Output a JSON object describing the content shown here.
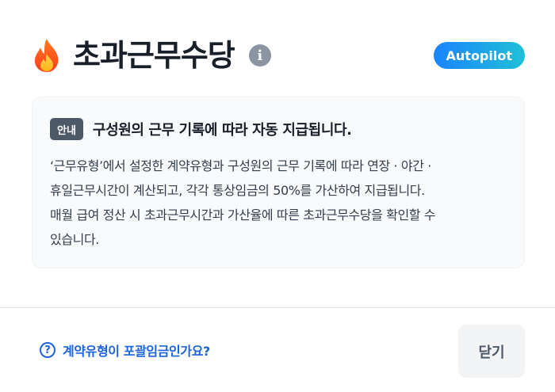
{
  "header": {
    "title": "초과근무수당",
    "info_icon": "i",
    "badge": "Autopilot"
  },
  "notice": {
    "tag": "안내",
    "title": "구성원의 근무 기록에 따라 자동 지급됩니다.",
    "lines": [
      "‘근무유형’에서 설정한 계약유형과 구성원의 근무 기록에 따라 연장 · 야간 ·",
      "휴일근무시간이 계산되고, 각각 통상임금의 50%를 가산하여 지급됩니다.",
      "매월 급여 정산 시 초과근무시간과 가산율에 따른 초과근무수당을 확인할 수",
      "있습니다."
    ]
  },
  "footer": {
    "help_icon": "?",
    "link_label": "계약유형이 포괄임금인가요?",
    "close_label": "닫기"
  },
  "colors": {
    "accent": "#1b64da",
    "badge_gradient_start": "#1b84ff",
    "badge_gradient_end": "#1fc0d6",
    "tag_bg": "#4e5968",
    "card_bg": "#f9fafb"
  }
}
